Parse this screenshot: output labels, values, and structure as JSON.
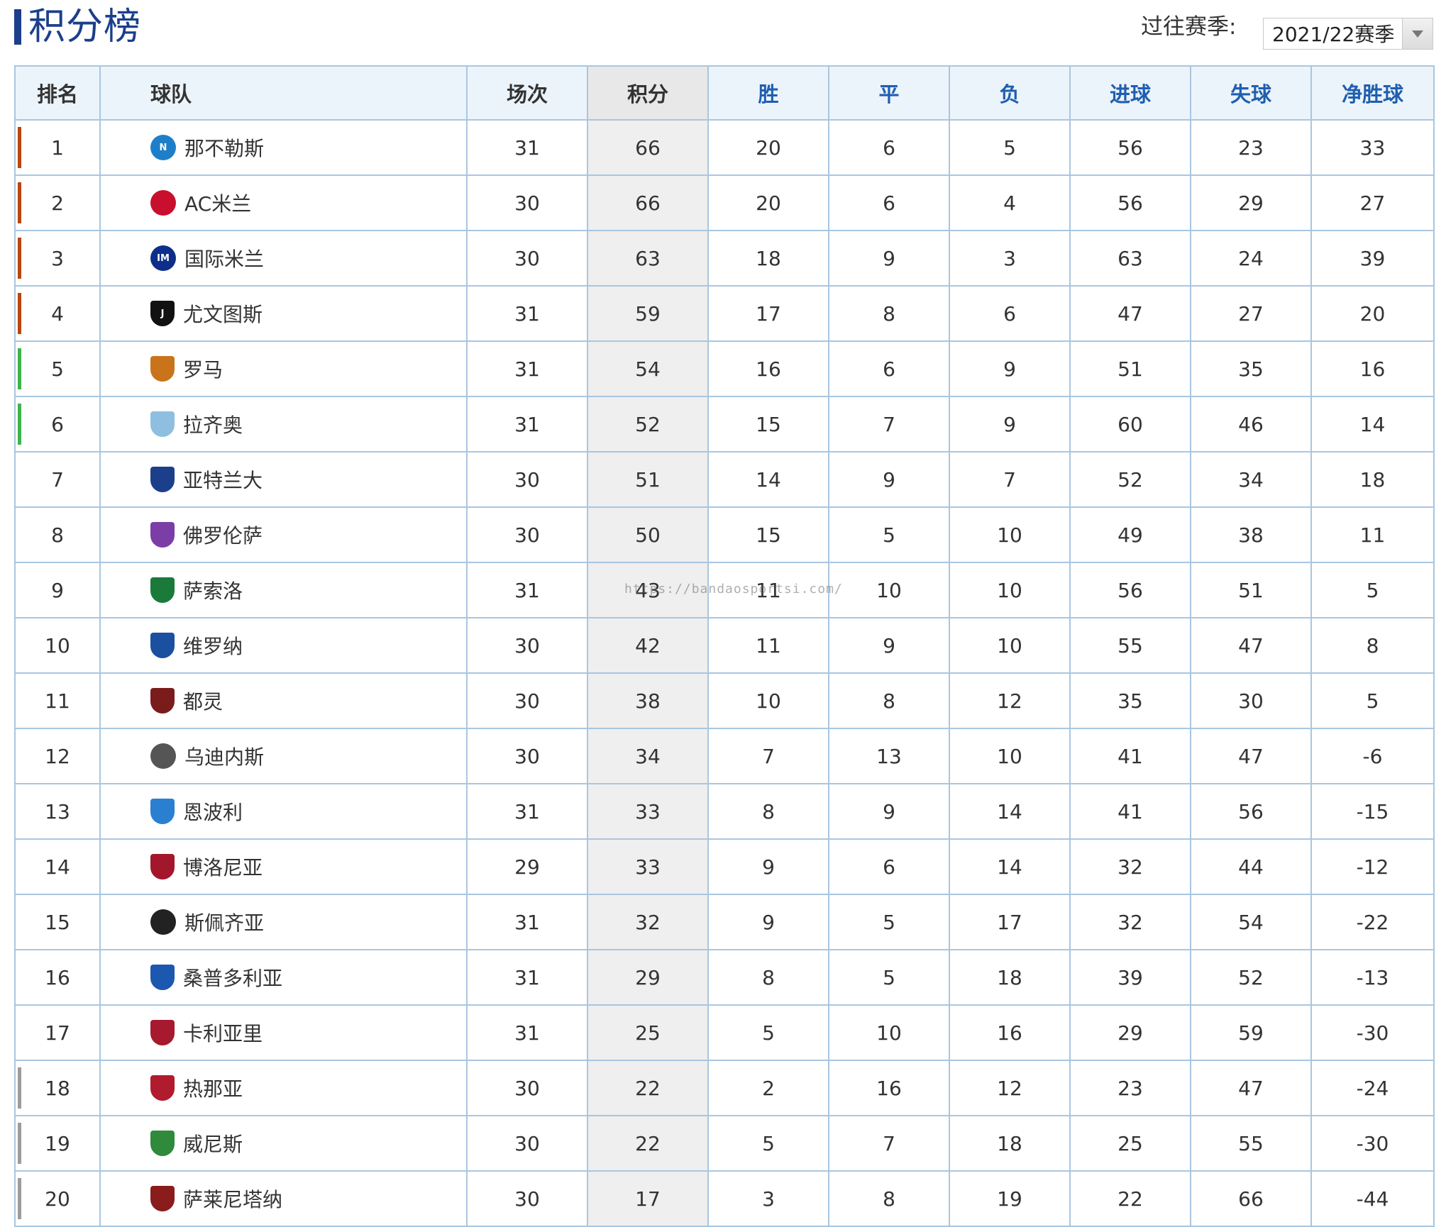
{
  "page": {
    "title": "积分榜",
    "season_label": "过往赛季:",
    "season_value": "2021/22赛季"
  },
  "columns": {
    "rank": "排名",
    "team": "球队",
    "played": "场次",
    "points": "积分",
    "won": "胜",
    "drawn": "平",
    "lost": "负",
    "goals_for": "进球",
    "goals_against": "失球",
    "goal_diff": "净胜球"
  },
  "colors": {
    "title": "#1b3f8b",
    "champions_zone": "#b8470f",
    "europa_zone": "#3db54a",
    "relegation_zone": "#9c9c9c"
  },
  "rows": [
    {
      "rank": "1",
      "team": "那不勒斯",
      "played": "31",
      "points": "66",
      "won": "20",
      "drawn": "6",
      "lost": "5",
      "goals_for": "56",
      "goals_against": "23",
      "goal_diff": "33",
      "zone": "cl",
      "crest_icon": "napoli-crest-icon",
      "crest_color": "#1e7fc9",
      "crest_shape": "round",
      "crest_text": "N"
    },
    {
      "rank": "2",
      "team": "AC米兰",
      "played": "30",
      "points": "66",
      "won": "20",
      "drawn": "6",
      "lost": "4",
      "goals_for": "56",
      "goals_against": "29",
      "goal_diff": "27",
      "zone": "cl",
      "crest_icon": "ac-milan-crest-icon",
      "crest_color": "#c8102e",
      "crest_shape": "round",
      "crest_text": ""
    },
    {
      "rank": "3",
      "team": "国际米兰",
      "played": "30",
      "points": "63",
      "won": "18",
      "drawn": "9",
      "lost": "3",
      "goals_for": "63",
      "goals_against": "24",
      "goal_diff": "39",
      "zone": "cl",
      "crest_icon": "inter-crest-icon",
      "crest_color": "#0d2f8a",
      "crest_shape": "round",
      "crest_text": "IM"
    },
    {
      "rank": "4",
      "team": "尤文图斯",
      "played": "31",
      "points": "59",
      "won": "17",
      "drawn": "8",
      "lost": "6",
      "goals_for": "47",
      "goals_against": "27",
      "goal_diff": "20",
      "zone": "cl",
      "crest_icon": "juventus-crest-icon",
      "crest_color": "#111111",
      "crest_shape": "shield",
      "crest_text": "J"
    },
    {
      "rank": "5",
      "team": "罗马",
      "played": "31",
      "points": "54",
      "won": "16",
      "drawn": "6",
      "lost": "9",
      "goals_for": "51",
      "goals_against": "35",
      "goal_diff": "16",
      "zone": "el",
      "crest_icon": "roma-crest-icon",
      "crest_color": "#c9741b",
      "crest_shape": "shield",
      "crest_text": ""
    },
    {
      "rank": "6",
      "team": "拉齐奥",
      "played": "31",
      "points": "52",
      "won": "15",
      "drawn": "7",
      "lost": "9",
      "goals_for": "60",
      "goals_against": "46",
      "goal_diff": "14",
      "zone": "el",
      "crest_icon": "lazio-crest-icon",
      "crest_color": "#8fbfe0",
      "crest_shape": "shield",
      "crest_text": ""
    },
    {
      "rank": "7",
      "team": "亚特兰大",
      "played": "30",
      "points": "51",
      "won": "14",
      "drawn": "9",
      "lost": "7",
      "goals_for": "52",
      "goals_against": "34",
      "goal_diff": "18",
      "zone": "",
      "crest_icon": "atalanta-crest-icon",
      "crest_color": "#1c3f8c",
      "crest_shape": "shield",
      "crest_text": ""
    },
    {
      "rank": "8",
      "team": "佛罗伦萨",
      "played": "30",
      "points": "50",
      "won": "15",
      "drawn": "5",
      "lost": "10",
      "goals_for": "49",
      "goals_against": "38",
      "goal_diff": "11",
      "zone": "",
      "crest_icon": "fiorentina-crest-icon",
      "crest_color": "#7a3ea6",
      "crest_shape": "shield",
      "crest_text": ""
    },
    {
      "rank": "9",
      "team": "萨索洛",
      "played": "31",
      "points": "43",
      "won": "11",
      "drawn": "10",
      "lost": "10",
      "goals_for": "56",
      "goals_against": "51",
      "goal_diff": "5",
      "zone": "",
      "crest_icon": "sassuolo-crest-icon",
      "crest_color": "#1a7a3a",
      "crest_shape": "shield",
      "crest_text": ""
    },
    {
      "rank": "10",
      "team": "维罗纳",
      "played": "30",
      "points": "42",
      "won": "11",
      "drawn": "9",
      "lost": "10",
      "goals_for": "55",
      "goals_against": "47",
      "goal_diff": "8",
      "zone": "",
      "crest_icon": "verona-crest-icon",
      "crest_color": "#1b4fa0",
      "crest_shape": "shield",
      "crest_text": ""
    },
    {
      "rank": "11",
      "team": "都灵",
      "played": "30",
      "points": "38",
      "won": "10",
      "drawn": "8",
      "lost": "12",
      "goals_for": "35",
      "goals_against": "30",
      "goal_diff": "5",
      "zone": "",
      "crest_icon": "torino-crest-icon",
      "crest_color": "#7b1c1c",
      "crest_shape": "shield",
      "crest_text": ""
    },
    {
      "rank": "12",
      "team": "乌迪内斯",
      "played": "30",
      "points": "34",
      "won": "7",
      "drawn": "13",
      "lost": "10",
      "goals_for": "41",
      "goals_against": "47",
      "goal_diff": "-6",
      "zone": "",
      "crest_icon": "udinese-crest-icon",
      "crest_color": "#555555",
      "crest_shape": "round",
      "crest_text": ""
    },
    {
      "rank": "13",
      "team": "恩波利",
      "played": "31",
      "points": "33",
      "won": "8",
      "drawn": "9",
      "lost": "14",
      "goals_for": "41",
      "goals_against": "56",
      "goal_diff": "-15",
      "zone": "",
      "crest_icon": "empoli-crest-icon",
      "crest_color": "#2b7fd0",
      "crest_shape": "shield",
      "crest_text": ""
    },
    {
      "rank": "14",
      "team": "博洛尼亚",
      "played": "29",
      "points": "33",
      "won": "9",
      "drawn": "6",
      "lost": "14",
      "goals_for": "32",
      "goals_against": "44",
      "goal_diff": "-12",
      "zone": "",
      "crest_icon": "bologna-crest-icon",
      "crest_color": "#a3162b",
      "crest_shape": "shield",
      "crest_text": ""
    },
    {
      "rank": "15",
      "team": "斯佩齐亚",
      "played": "31",
      "points": "32",
      "won": "9",
      "drawn": "5",
      "lost": "17",
      "goals_for": "32",
      "goals_against": "54",
      "goal_diff": "-22",
      "zone": "",
      "crest_icon": "spezia-crest-icon",
      "crest_color": "#222222",
      "crest_shape": "round",
      "crest_text": ""
    },
    {
      "rank": "16",
      "team": "桑普多利亚",
      "played": "31",
      "points": "29",
      "won": "8",
      "drawn": "5",
      "lost": "18",
      "goals_for": "39",
      "goals_against": "52",
      "goal_diff": "-13",
      "zone": "",
      "crest_icon": "sampdoria-crest-icon",
      "crest_color": "#1c57b0",
      "crest_shape": "shield",
      "crest_text": ""
    },
    {
      "rank": "17",
      "team": "卡利亚里",
      "played": "31",
      "points": "25",
      "won": "5",
      "drawn": "10",
      "lost": "16",
      "goals_for": "29",
      "goals_against": "59",
      "goal_diff": "-30",
      "zone": "",
      "crest_icon": "cagliari-crest-icon",
      "crest_color": "#a6192e",
      "crest_shape": "shield",
      "crest_text": ""
    },
    {
      "rank": "18",
      "team": "热那亚",
      "played": "30",
      "points": "22",
      "won": "2",
      "drawn": "16",
      "lost": "12",
      "goals_for": "23",
      "goals_against": "47",
      "goal_diff": "-24",
      "zone": "rel",
      "crest_icon": "genoa-crest-icon",
      "crest_color": "#b01b2e",
      "crest_shape": "shield",
      "crest_text": ""
    },
    {
      "rank": "19",
      "team": "威尼斯",
      "played": "30",
      "points": "22",
      "won": "5",
      "drawn": "7",
      "lost": "18",
      "goals_for": "25",
      "goals_against": "55",
      "goal_diff": "-30",
      "zone": "rel",
      "crest_icon": "venezia-crest-icon",
      "crest_color": "#2f8a3c",
      "crest_shape": "shield",
      "crest_text": ""
    },
    {
      "rank": "20",
      "team": "萨莱尼塔纳",
      "played": "30",
      "points": "17",
      "won": "3",
      "drawn": "8",
      "lost": "19",
      "goals_for": "22",
      "goals_against": "66",
      "goal_diff": "-44",
      "zone": "rel",
      "crest_icon": "salernitana-crest-icon",
      "crest_color": "#8a1c1c",
      "crest_shape": "shield",
      "crest_text": ""
    }
  ],
  "watermark": "https://bandaosportsi.com/"
}
